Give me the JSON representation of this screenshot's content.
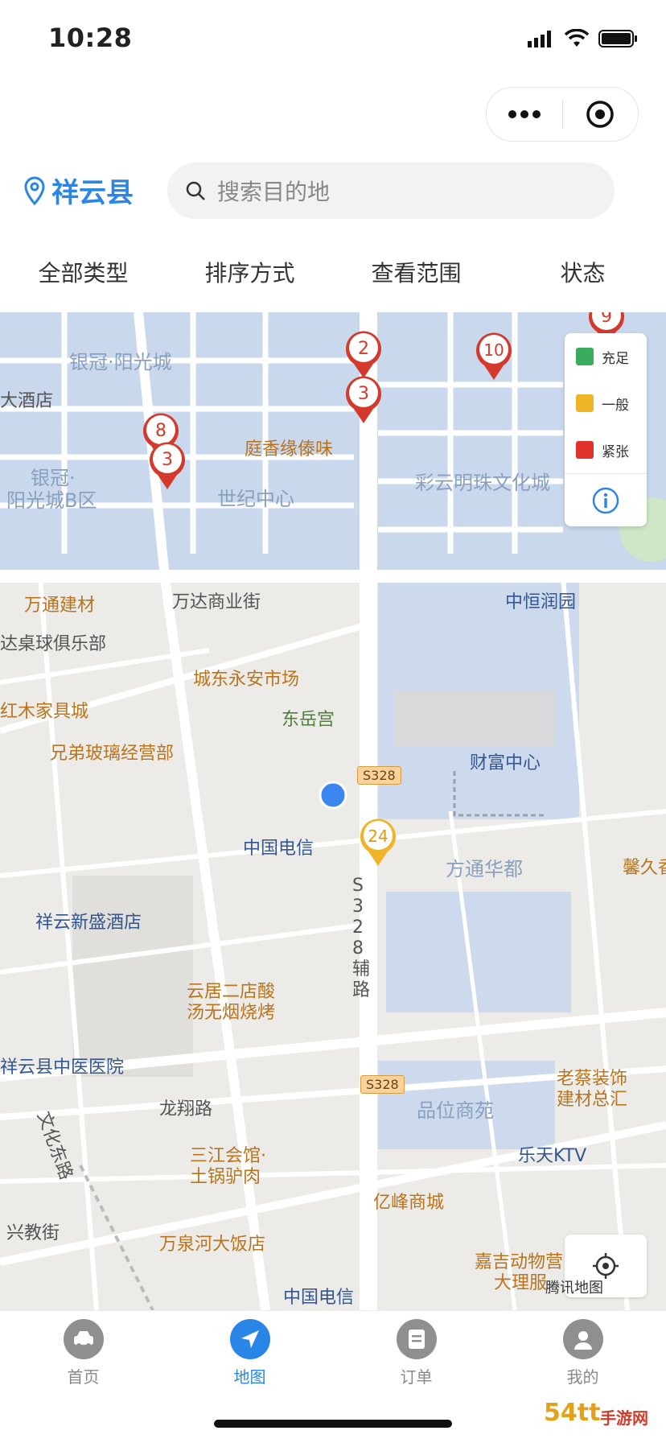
{
  "status_bar": {
    "time": "10:28"
  },
  "header": {
    "location": "祥云县",
    "search_placeholder": "搜索目的地"
  },
  "filters": [
    "全部类型",
    "排序方式",
    "查看范围",
    "状态"
  ],
  "map": {
    "areas": [
      "银冠·阳光城",
      "银冠·",
      "阳光城B区",
      "世纪中心",
      "彩云明珠文化城",
      "方通华都",
      "品位商苑"
    ],
    "pois": [
      "大酒店",
      "庭香缘傣味",
      "万通建材",
      "万达商业街",
      "中恒润园",
      "达桌球俱乐部",
      "城东永安市场",
      "红木家具城",
      "东岳宫",
      "兄弟玻璃经营部",
      "财富中心",
      "中国电信",
      "馨久香",
      "祥云新盛酒店",
      "云居二店酸",
      "汤无烟烧烤",
      "祥云县中医医院",
      "老蔡装饰",
      "建材总汇",
      "龙翔路",
      "文化东路",
      "三江会馆·",
      "土锅驴肉",
      "乐天KTV",
      "兴教街",
      "亿峰商城",
      "万泉河大饭店",
      "嘉吉动物营",
      "大理服",
      "中国电信",
      "S328辅路"
    ],
    "road_badges": [
      "S328",
      "S328"
    ],
    "markers": [
      {
        "label": "2",
        "color": "#d33a2c"
      },
      {
        "label": "3",
        "color": "#d33a2c"
      },
      {
        "label": "10",
        "color": "#d33a2c"
      },
      {
        "label": "9",
        "color": "#d33a2c"
      },
      {
        "label": "8",
        "color": "#d33a2c"
      },
      {
        "label": "3",
        "color": "#d33a2c"
      },
      {
        "label": "24",
        "color": "#f0b429"
      }
    ],
    "watermark": "腾讯地图"
  },
  "legend": [
    {
      "label": "充足",
      "color": "#3bab5e"
    },
    {
      "label": "一般",
      "color": "#f0b429"
    },
    {
      "label": "紧张",
      "color": "#e0322b"
    }
  ],
  "tabs": [
    {
      "label": "首页",
      "icon": "car-icon"
    },
    {
      "label": "地图",
      "icon": "navigation-arrow-icon",
      "active": true
    },
    {
      "label": "订单",
      "icon": "document-icon"
    },
    {
      "label": "我的",
      "icon": "user-icon"
    }
  ],
  "overlay_brand": {
    "main": "54tt",
    "sub": "手游网"
  },
  "colors": {
    "accent": "#2a86e6",
    "marker": "#d33a2c",
    "marker_yellow": "#f0b429"
  }
}
